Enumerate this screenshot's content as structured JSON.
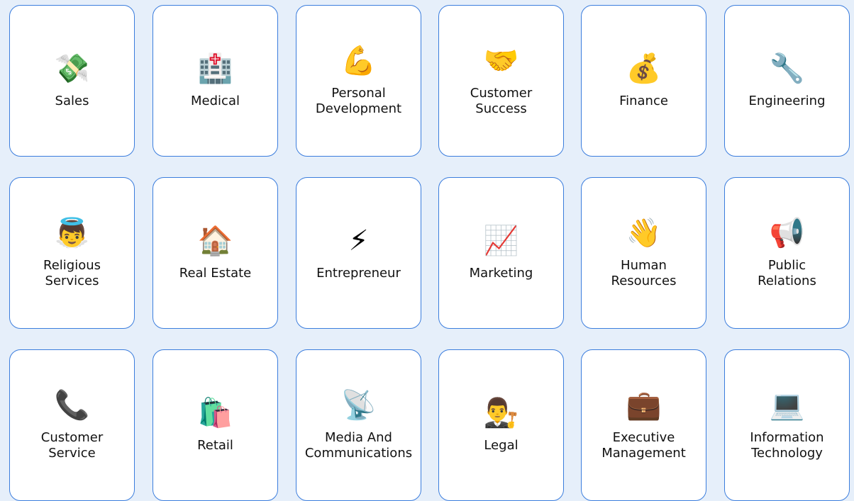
{
  "categories": [
    {
      "label": "Sales",
      "icon": "💸",
      "icon_name": "money-with-wings-icon"
    },
    {
      "label": "Medical",
      "icon": "🏥",
      "icon_name": "hospital-icon"
    },
    {
      "label": "Personal\nDevelopment",
      "icon": "💪",
      "icon_name": "flexed-biceps-icon"
    },
    {
      "label": "Customer\nSuccess",
      "icon": "🤝",
      "icon_name": "handshake-icon"
    },
    {
      "label": "Finance",
      "icon": "💰",
      "icon_name": "money-bag-icon"
    },
    {
      "label": "Engineering",
      "icon": "🔧",
      "icon_name": "wrench-icon"
    },
    {
      "label": "Religious\nServices",
      "icon": "👼",
      "icon_name": "baby-angel-icon"
    },
    {
      "label": "Real Estate",
      "icon": "🏠",
      "icon_name": "house-icon"
    },
    {
      "label": "Entrepreneur",
      "icon": "⚡",
      "icon_name": "lightning-icon"
    },
    {
      "label": "Marketing",
      "icon": "📈",
      "icon_name": "chart-increasing-icon"
    },
    {
      "label": "Human\nResources",
      "icon": "👋",
      "icon_name": "waving-hand-icon"
    },
    {
      "label": "Public\nRelations",
      "icon": "📢",
      "icon_name": "megaphone-icon"
    },
    {
      "label": "Customer\nService",
      "icon": "📞",
      "icon_name": "telephone-receiver-icon"
    },
    {
      "label": "Retail",
      "icon": "🛍️",
      "icon_name": "shopping-bags-icon"
    },
    {
      "label": "Media And\nCommunications",
      "icon": "📡",
      "icon_name": "satellite-antenna-icon"
    },
    {
      "label": "Legal",
      "icon": "👨‍⚖️",
      "icon_name": "judge-icon"
    },
    {
      "label": "Executive\nManagement",
      "icon": "💼",
      "icon_name": "briefcase-icon"
    },
    {
      "label": "Information\nTechnology",
      "icon": "💻",
      "icon_name": "laptop-icon"
    }
  ],
  "colors": {
    "background": "#e6effa",
    "card_border": "#3b7ddd",
    "card_background": "#ffffff",
    "text": "#111111"
  }
}
